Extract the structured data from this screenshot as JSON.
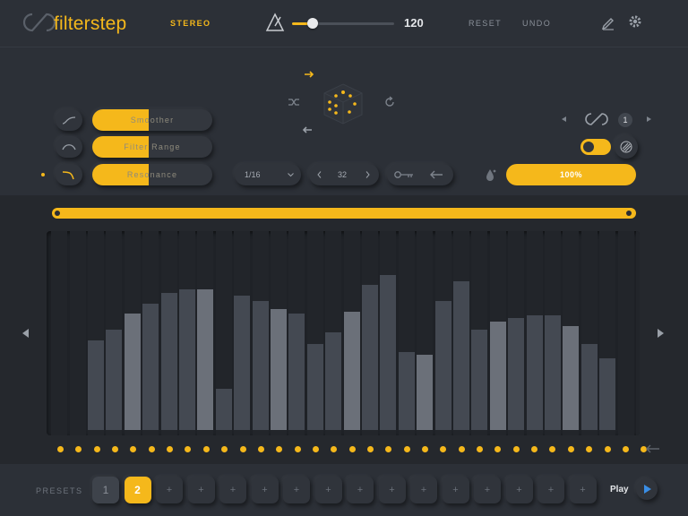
{
  "header": {
    "app_name": "filterstep",
    "stereo_label": "STEREO",
    "tempo": "120",
    "tempo_fill": 0.2,
    "reset_label": "RESET",
    "undo_label": "UNDO"
  },
  "params": [
    {
      "label": "Smoother",
      "value": 0.47
    },
    {
      "label": "Filter Range",
      "value": 0.47
    },
    {
      "label": "Resonance",
      "value": 0.47
    }
  ],
  "controls": {
    "step_length": "1/16",
    "step_count": "32",
    "loop_count": "1",
    "mix_value": "100%"
  },
  "sequencer": {
    "values": [
      0.44,
      0.49,
      0.57,
      0.62,
      0.67,
      0.69,
      0.69,
      0.2,
      0.66,
      0.63,
      0.59,
      0.57,
      0.42,
      0.48,
      0.58,
      0.71,
      0.76,
      0.38,
      0.37,
      0.63,
      0.73,
      0.49,
      0.53,
      0.55,
      0.56,
      0.56,
      0.51,
      0.42,
      0.35
    ],
    "shades": [
      "d",
      "d",
      "l",
      "d",
      "d",
      "d",
      "l",
      "d",
      "d",
      "d",
      "l",
      "d",
      "d",
      "d",
      "l",
      "d",
      "d",
      "d",
      "l",
      "d",
      "d",
      "d",
      "l",
      "d",
      "d",
      "d",
      "l",
      "d",
      "d"
    ],
    "step_dots": 33
  },
  "footer": {
    "presets_label": "PRESETS",
    "presets": [
      "1",
      "2",
      "+",
      "+",
      "+",
      "+",
      "+",
      "+",
      "+",
      "+",
      "+",
      "+",
      "+",
      "+",
      "+",
      "+"
    ],
    "active_preset": 1,
    "play_label": "Play"
  },
  "colors": {
    "accent": "#f5b81b",
    "background": "#2c3037",
    "panel": "#25282d"
  }
}
